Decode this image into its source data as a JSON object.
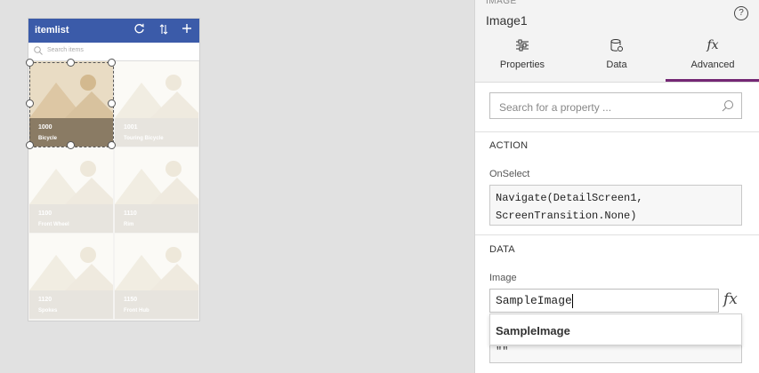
{
  "canvas": {
    "title": "itemlist",
    "header_icons": [
      "refresh-icon",
      "sort-icon",
      "add-icon"
    ],
    "search_placeholder": "Search items",
    "tiles": [
      {
        "id": "1000",
        "name": "Bicycle",
        "selected": true
      },
      {
        "id": "1001",
        "name": "Touring Bicycle",
        "selected": false
      },
      {
        "id": "1100",
        "name": "Front Wheel",
        "selected": false
      },
      {
        "id": "1110",
        "name": "Rim",
        "selected": false
      },
      {
        "id": "1120",
        "name": "Spokes",
        "selected": false
      },
      {
        "id": "1150",
        "name": "Front Hub",
        "selected": false
      }
    ]
  },
  "panel": {
    "control_type": "IMAGE",
    "control_name": "Image1",
    "help": "?",
    "tabs": [
      {
        "label": "Properties",
        "icon": "sliders-icon",
        "active": false
      },
      {
        "label": "Data",
        "icon": "database-icon",
        "active": false
      },
      {
        "label": "Advanced",
        "icon": "fx-icon",
        "active": true
      }
    ],
    "search_placeholder": "Search for a property ...",
    "action": {
      "header": "ACTION",
      "label": "OnSelect",
      "line1": "Navigate(DetailScreen1,",
      "line2": "ScreenTransition.None)"
    },
    "data": {
      "header": "DATA",
      "label": "Image",
      "value": "SampleImage",
      "fx": "fx",
      "suggestion": "SampleImage",
      "under_value": "\"\""
    }
  },
  "colors": {
    "header_blue": "#3b5ba9",
    "accent_purple": "#742774"
  }
}
